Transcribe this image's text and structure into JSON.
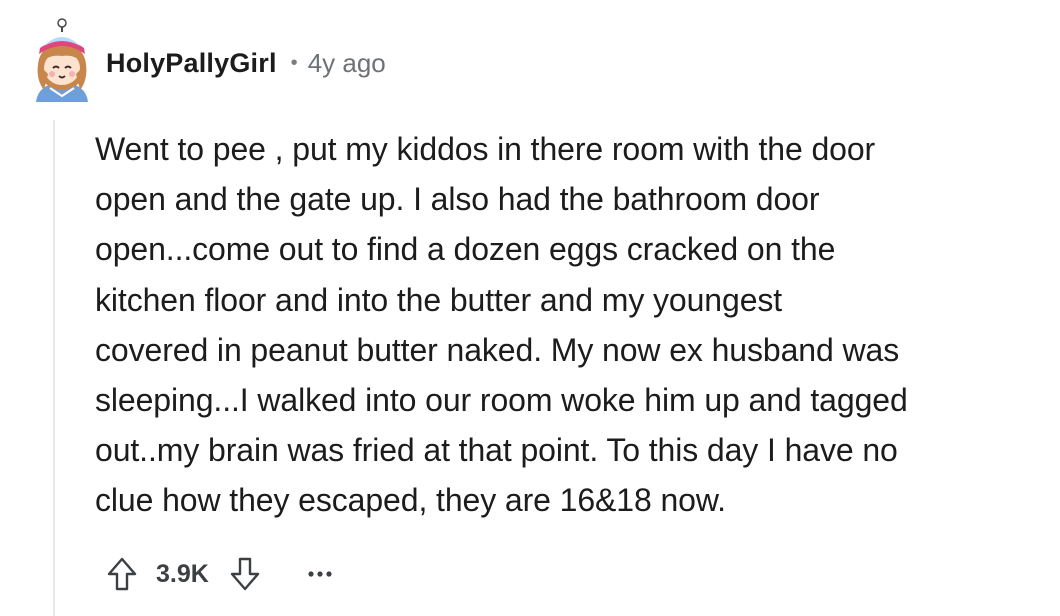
{
  "comment": {
    "author": "HolyPallyGirl",
    "separator": "•",
    "age": "4y ago",
    "avatar_icon": "snoo-avatar-icon",
    "body_lines": [
      "Went to pee , put my kiddos in there room with the door",
      "open and the gate up. I also had the bathroom door",
      "open...come out to find a dozen eggs cracked on the",
      "kitchen floor and into the butter and my youngest",
      "covered in peanut butter naked. My now ex husband was",
      "sleeping...I walked into our room woke him up and tagged",
      "out..my brain was fried at that point. To this day I have no",
      "clue how they escaped, they are 16&18 now."
    ],
    "score": "3.9K",
    "upvote_icon": "upvote-arrow-icon",
    "downvote_icon": "downvote-arrow-icon",
    "more_icon": "more-options-icon"
  },
  "colors": {
    "text": "#1c1c1c",
    "muted": "#6f7275",
    "thread_line": "#e6e8ea"
  }
}
